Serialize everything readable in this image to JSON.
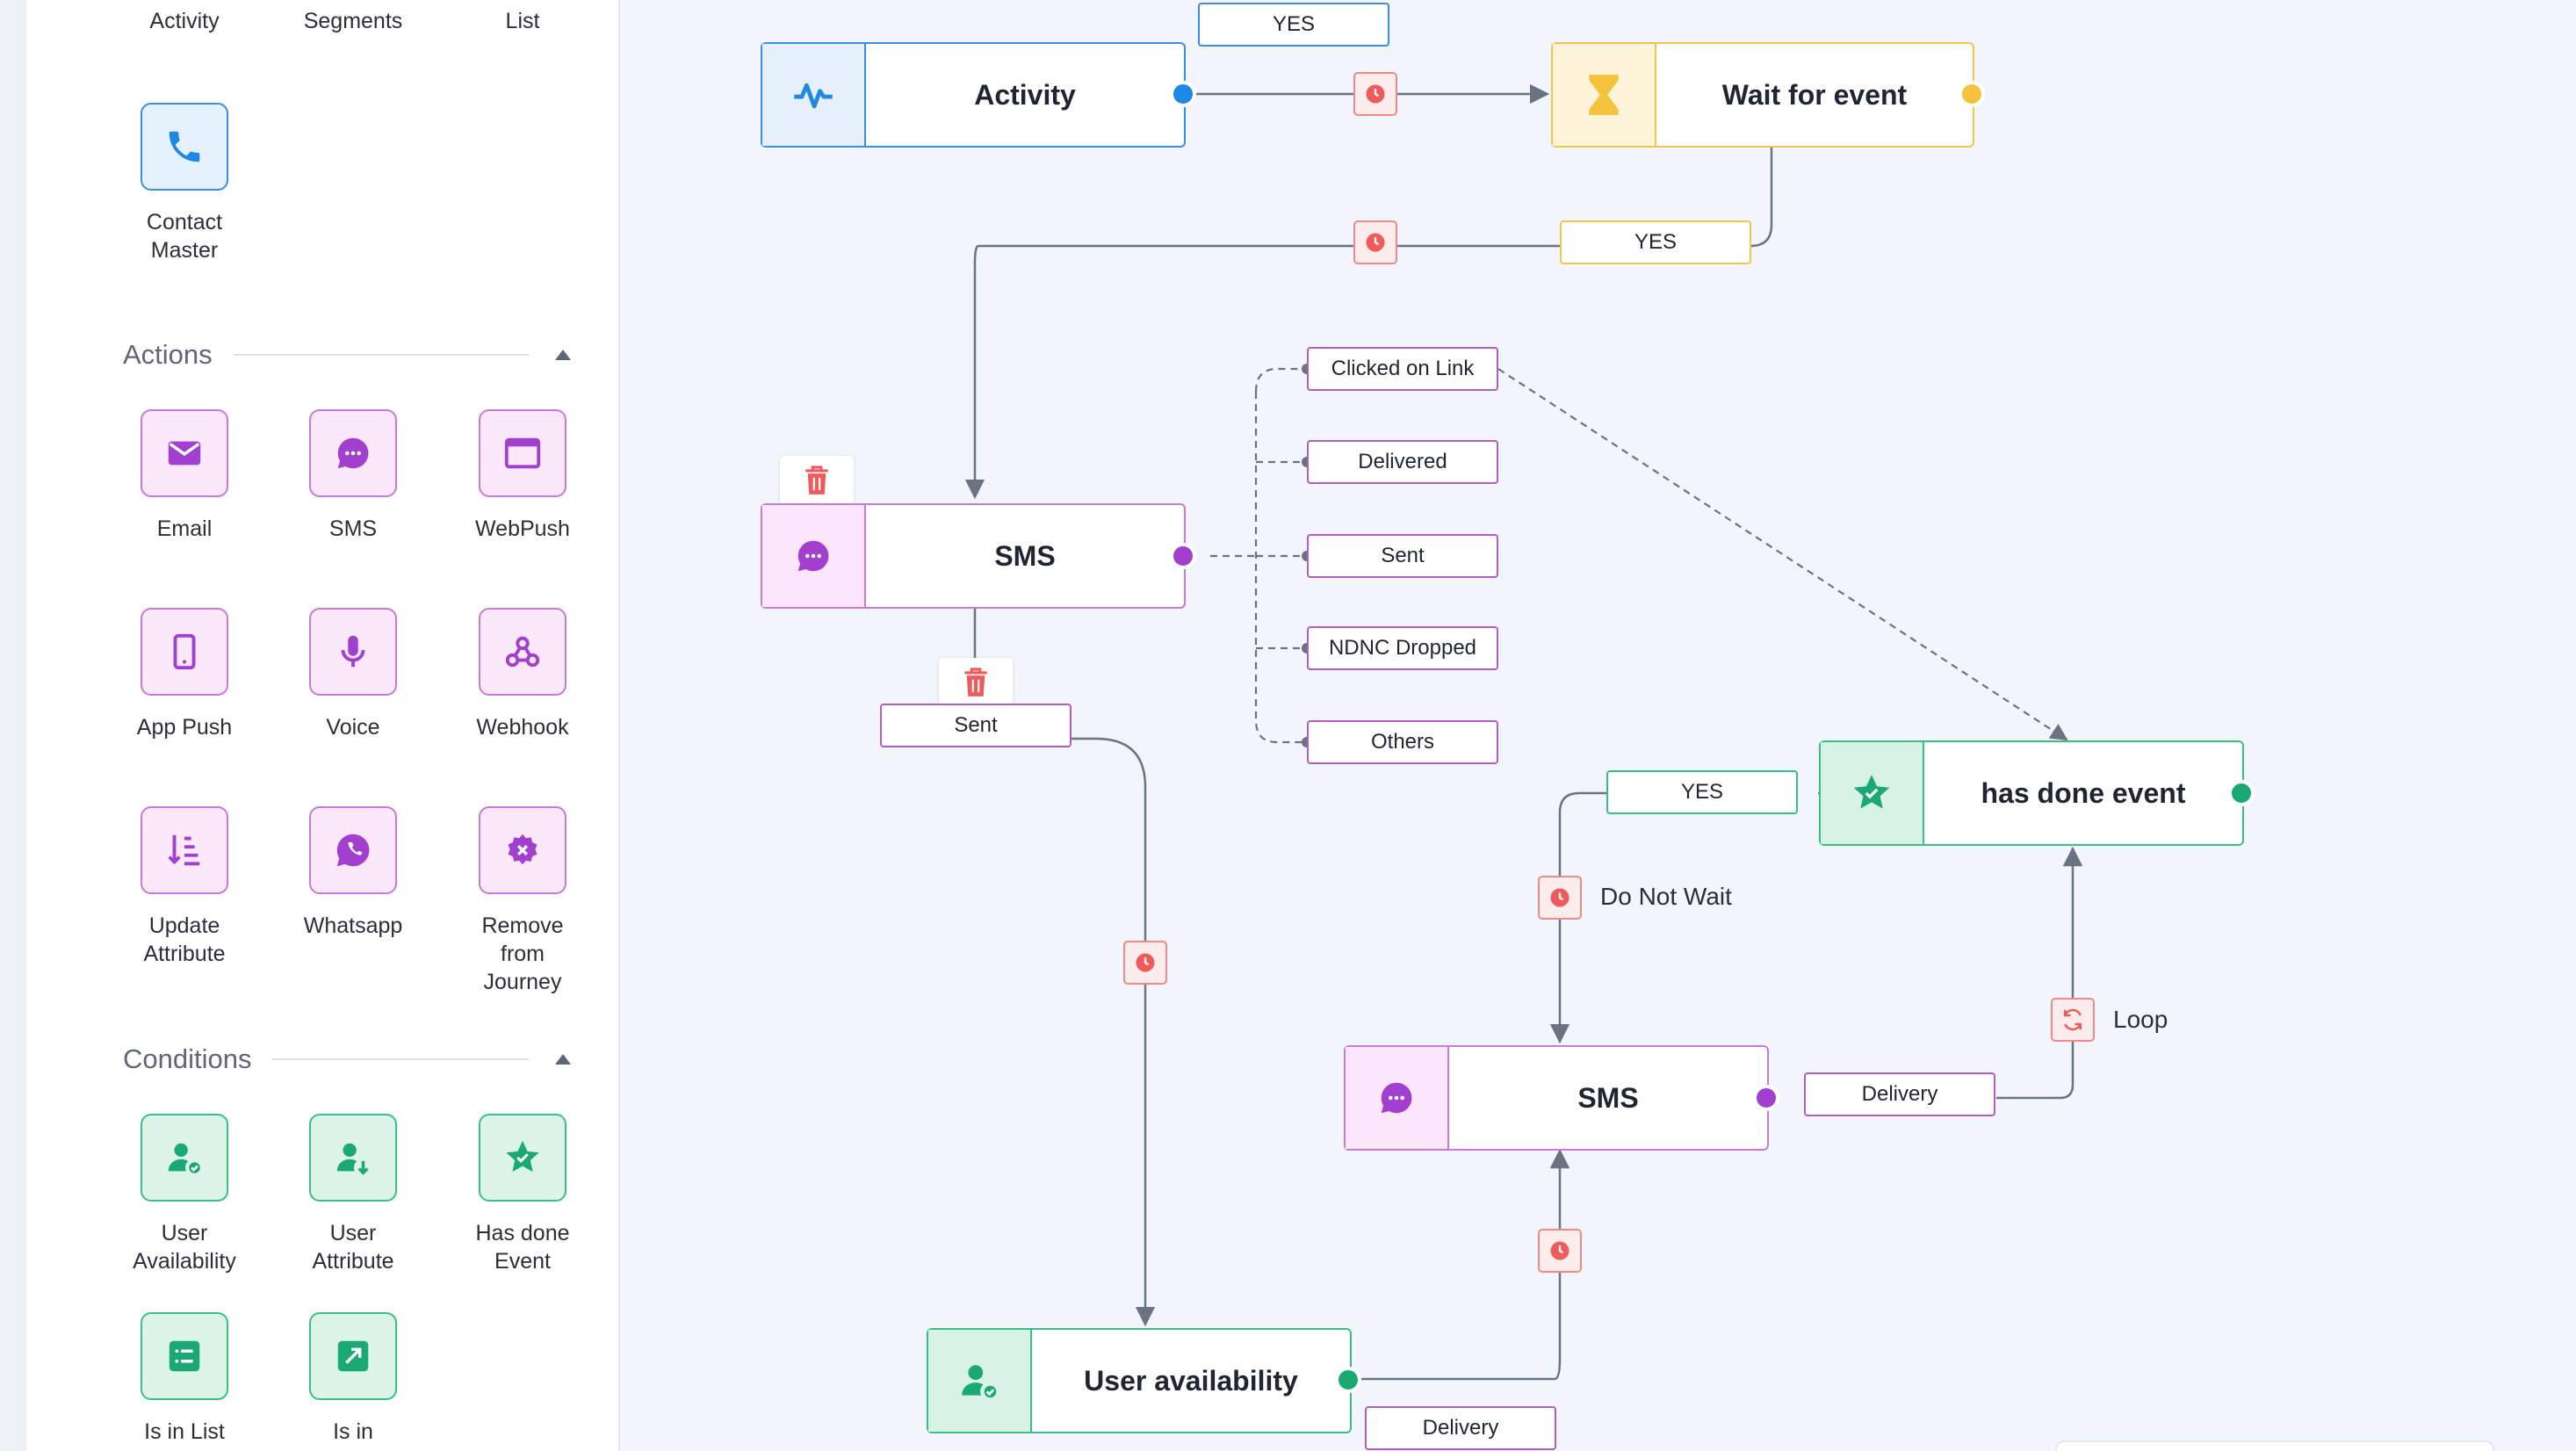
{
  "sidebar": {
    "top_items": [
      "Activity",
      "Segments",
      "List"
    ],
    "contact_master_label": "Contact\nMaster",
    "actions_title": "Actions",
    "actions": [
      "Email",
      "SMS",
      "WebPush",
      "App Push",
      "Voice",
      "Webhook",
      "Update\nAttribute",
      "Whatsapp",
      "Remove\nfrom\nJourney"
    ],
    "conditions_title": "Conditions",
    "conditions": [
      "User\nAvailability",
      "User\nAttribute",
      "Has done\nEvent",
      "Is in List",
      "Is in"
    ]
  },
  "canvas": {
    "nodes": {
      "activity": "Activity",
      "wait_for_event": "Wait for event",
      "sms_main": "SMS",
      "has_done_event": "has done event",
      "sms_second": "SMS",
      "user_availability": "User availability"
    },
    "tags": {
      "yes_top": "YES",
      "yes_wait": "YES",
      "clicked_on_link": "Clicked on Link",
      "delivered": "Delivered",
      "sent_branch": "Sent",
      "ndnc_dropped": "NDNC Dropped",
      "others": "Others",
      "sent_below": "Sent",
      "yes_has_done": "YES",
      "delivery_sms": "Delivery",
      "delivery_user": "Delivery"
    },
    "notes": {
      "do_not_wait": "Do Not Wait",
      "loop": "Loop"
    }
  },
  "colors": {
    "email_sms_purple": "#a23fcf",
    "condition_green": "#1aa873",
    "activity_blue": "#1e88e5",
    "wait_yellow": "#f5c33b",
    "timer_red": "#ef5b5b",
    "connector_gray": "#6b7282"
  }
}
